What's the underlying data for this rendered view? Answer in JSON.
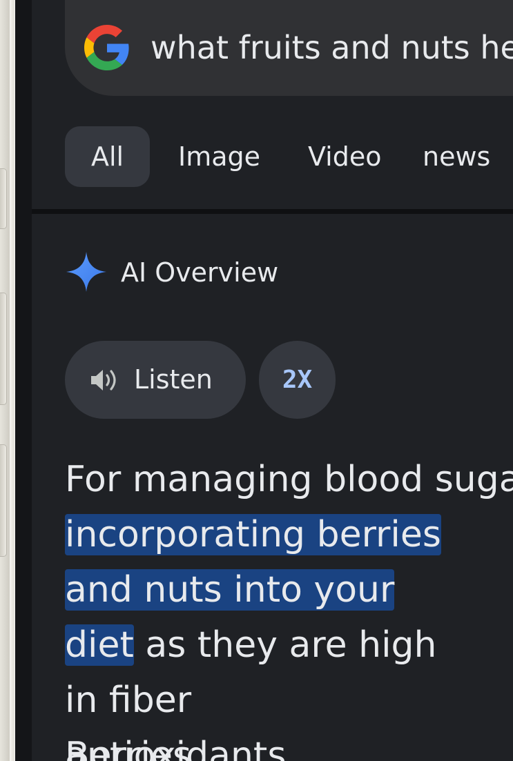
{
  "search": {
    "query": "what fruits and nuts help"
  },
  "tabs": [
    {
      "label": "All",
      "active": true
    },
    {
      "label": "Image",
      "active": false
    },
    {
      "label": "Video",
      "active": false
    },
    {
      "label": "news",
      "active": false
    }
  ],
  "ai_overview": {
    "title": "AI Overview",
    "listen_label": "Listen",
    "speed_label": "2X",
    "paragraph": {
      "part1": "For managing blood sugar",
      "highlight": "incorporating berries and nuts into your diet",
      "part2": "as they are high in fiber",
      "line4": "antioxidants."
    },
    "next_heading": "Berries"
  },
  "colors": {
    "background": "#1f2125",
    "surface": "#303134",
    "chip": "#35383f",
    "text": "#e8eaed",
    "highlight": "#1a4382",
    "accent": "#a8c7fa",
    "star": "#4285f4"
  },
  "icons": {
    "logo": "google-g-icon",
    "ai": "sparkle-icon",
    "listen": "speaker-icon"
  }
}
